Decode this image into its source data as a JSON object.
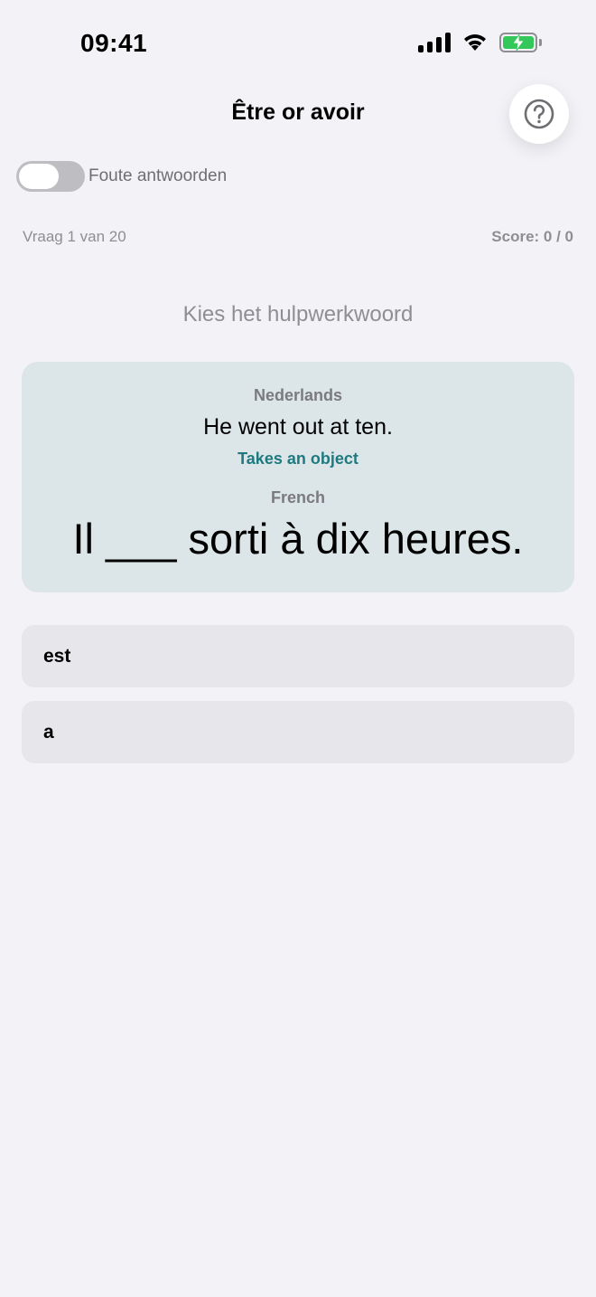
{
  "status_bar": {
    "time": "09:41",
    "icons": [
      "signal-icon",
      "wifi-icon",
      "battery-charging-icon"
    ],
    "battery_color": "#34C759"
  },
  "header": {
    "title": "Être or avoir",
    "help_icon": "question-circle-icon"
  },
  "toggle": {
    "label": "Foute antwoorden",
    "on": false
  },
  "progress": {
    "question": "Vraag 1 van 20",
    "score": "Score: 0 / 0"
  },
  "instruction": "Kies het hulpwerkwoord",
  "card": {
    "source_label": "Nederlands",
    "source_sentence": "He went out at ten.",
    "hint": "Takes an object",
    "target_label": "French",
    "target_sentence": "Il ___ sorti à dix heures.",
    "background": "#DCE6E8",
    "hint_color": "#1E7A80"
  },
  "options": [
    {
      "label": "est"
    },
    {
      "label": "a"
    }
  ]
}
